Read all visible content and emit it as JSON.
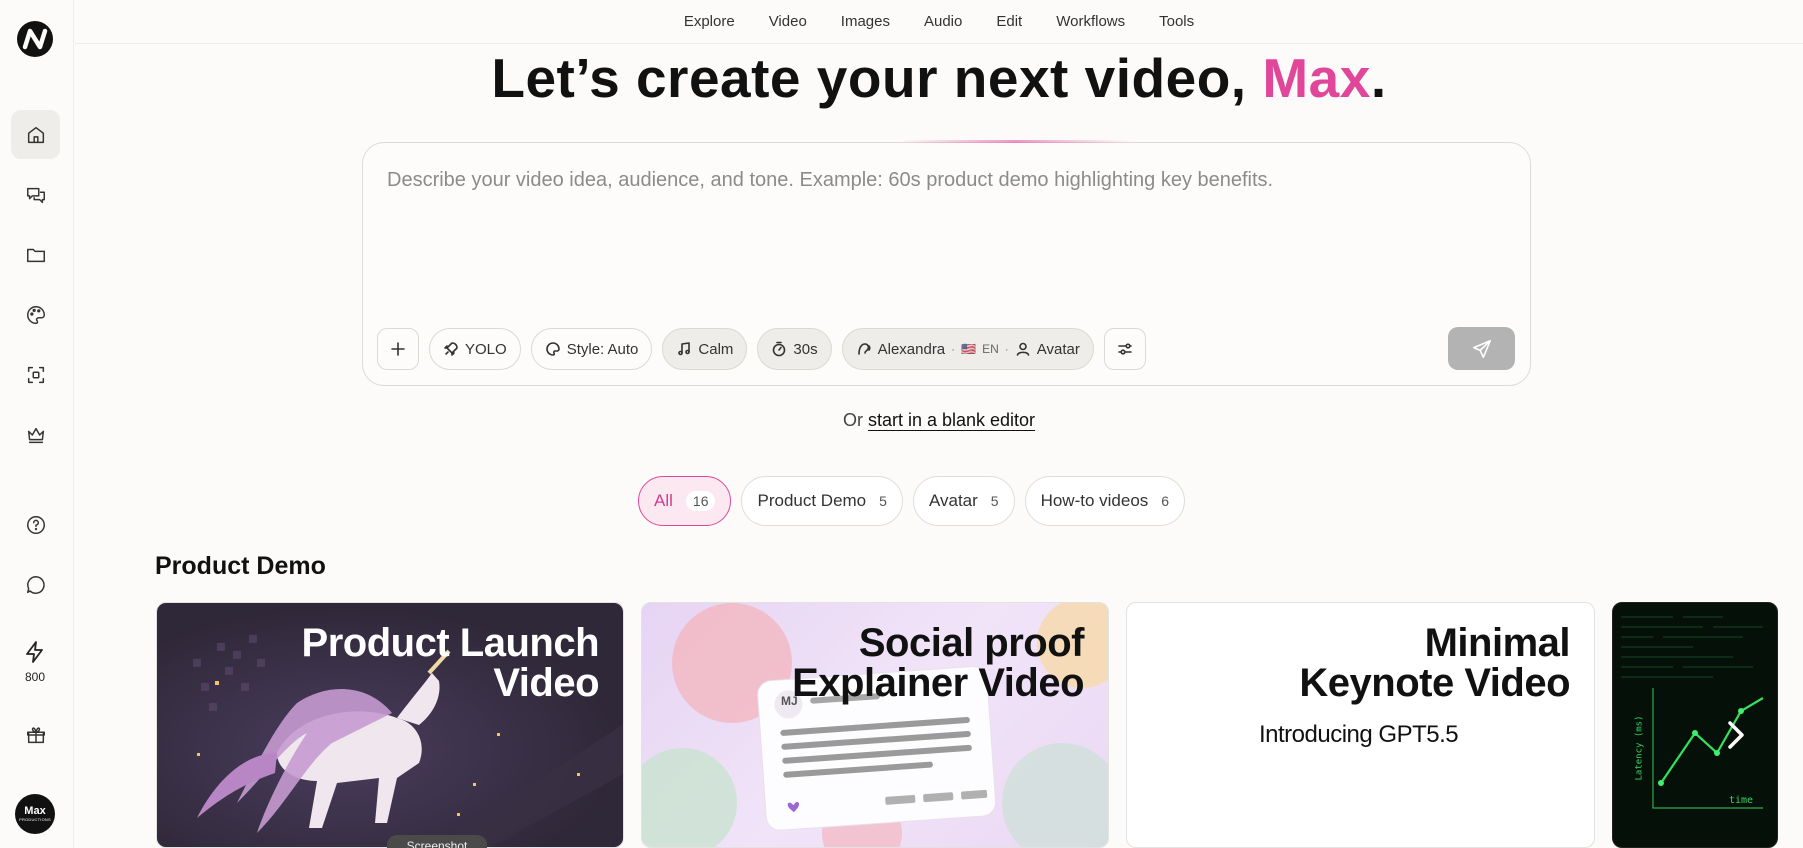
{
  "nav": {
    "items": [
      "Explore",
      "Video",
      "Images",
      "Audio",
      "Edit",
      "Workflows",
      "Tools"
    ]
  },
  "sidebar": {
    "items": [
      {
        "name": "home",
        "icon": "home-icon"
      },
      {
        "name": "chats",
        "icon": "chat-bubbles-icon"
      },
      {
        "name": "projects",
        "icon": "folder-icon"
      },
      {
        "name": "styles",
        "icon": "palette-icon"
      },
      {
        "name": "assets",
        "icon": "scan-square-icon"
      },
      {
        "name": "pro",
        "icon": "crown-icon"
      },
      {
        "name": "help",
        "icon": "help-icon"
      },
      {
        "name": "feedback",
        "icon": "message-circle-icon"
      },
      {
        "name": "rewards",
        "icon": "gift-icon"
      }
    ],
    "credits": "800",
    "avatar": {
      "label": "Max",
      "sub": "PRODUCTIONS"
    }
  },
  "hero": {
    "prefix": "Let’s create your next video, ",
    "name": "Max",
    "suffix": ".",
    "accent_color": "#e0479a"
  },
  "prompt": {
    "placeholder": "Describe your video idea, audience, and tone. Example: 60s product demo highlighting key benefits.",
    "value": ""
  },
  "toolbar": {
    "yolo": "YOLO",
    "style": "Style: Auto",
    "music": "Calm",
    "duration": "30s",
    "voice": "Alexandra",
    "flag": "🇺🇸",
    "language": "EN",
    "avatar": "Avatar"
  },
  "blank": {
    "prefix": "Or ",
    "link": "start in a blank editor"
  },
  "filters": [
    {
      "label": "All",
      "count": "16",
      "active": true
    },
    {
      "label": "Product Demo",
      "count": "5",
      "active": false
    },
    {
      "label": "Avatar",
      "count": "5",
      "active": false
    },
    {
      "label": "How-to videos",
      "count": "6",
      "active": false
    }
  ],
  "section": {
    "title": "Product Demo"
  },
  "cards": [
    {
      "line1": "Product Launch",
      "line2": "Video"
    },
    {
      "line1": "Social proof",
      "line2": "Explainer Video",
      "mock_initials": "MJ"
    },
    {
      "line1": "Minimal",
      "line2": "Keynote Video",
      "subtitle": "Introducing GPT5.5"
    },
    {
      "ylabel": "Latency (ms)",
      "xlabel": "time"
    }
  ],
  "tooltip": "Screenshot"
}
